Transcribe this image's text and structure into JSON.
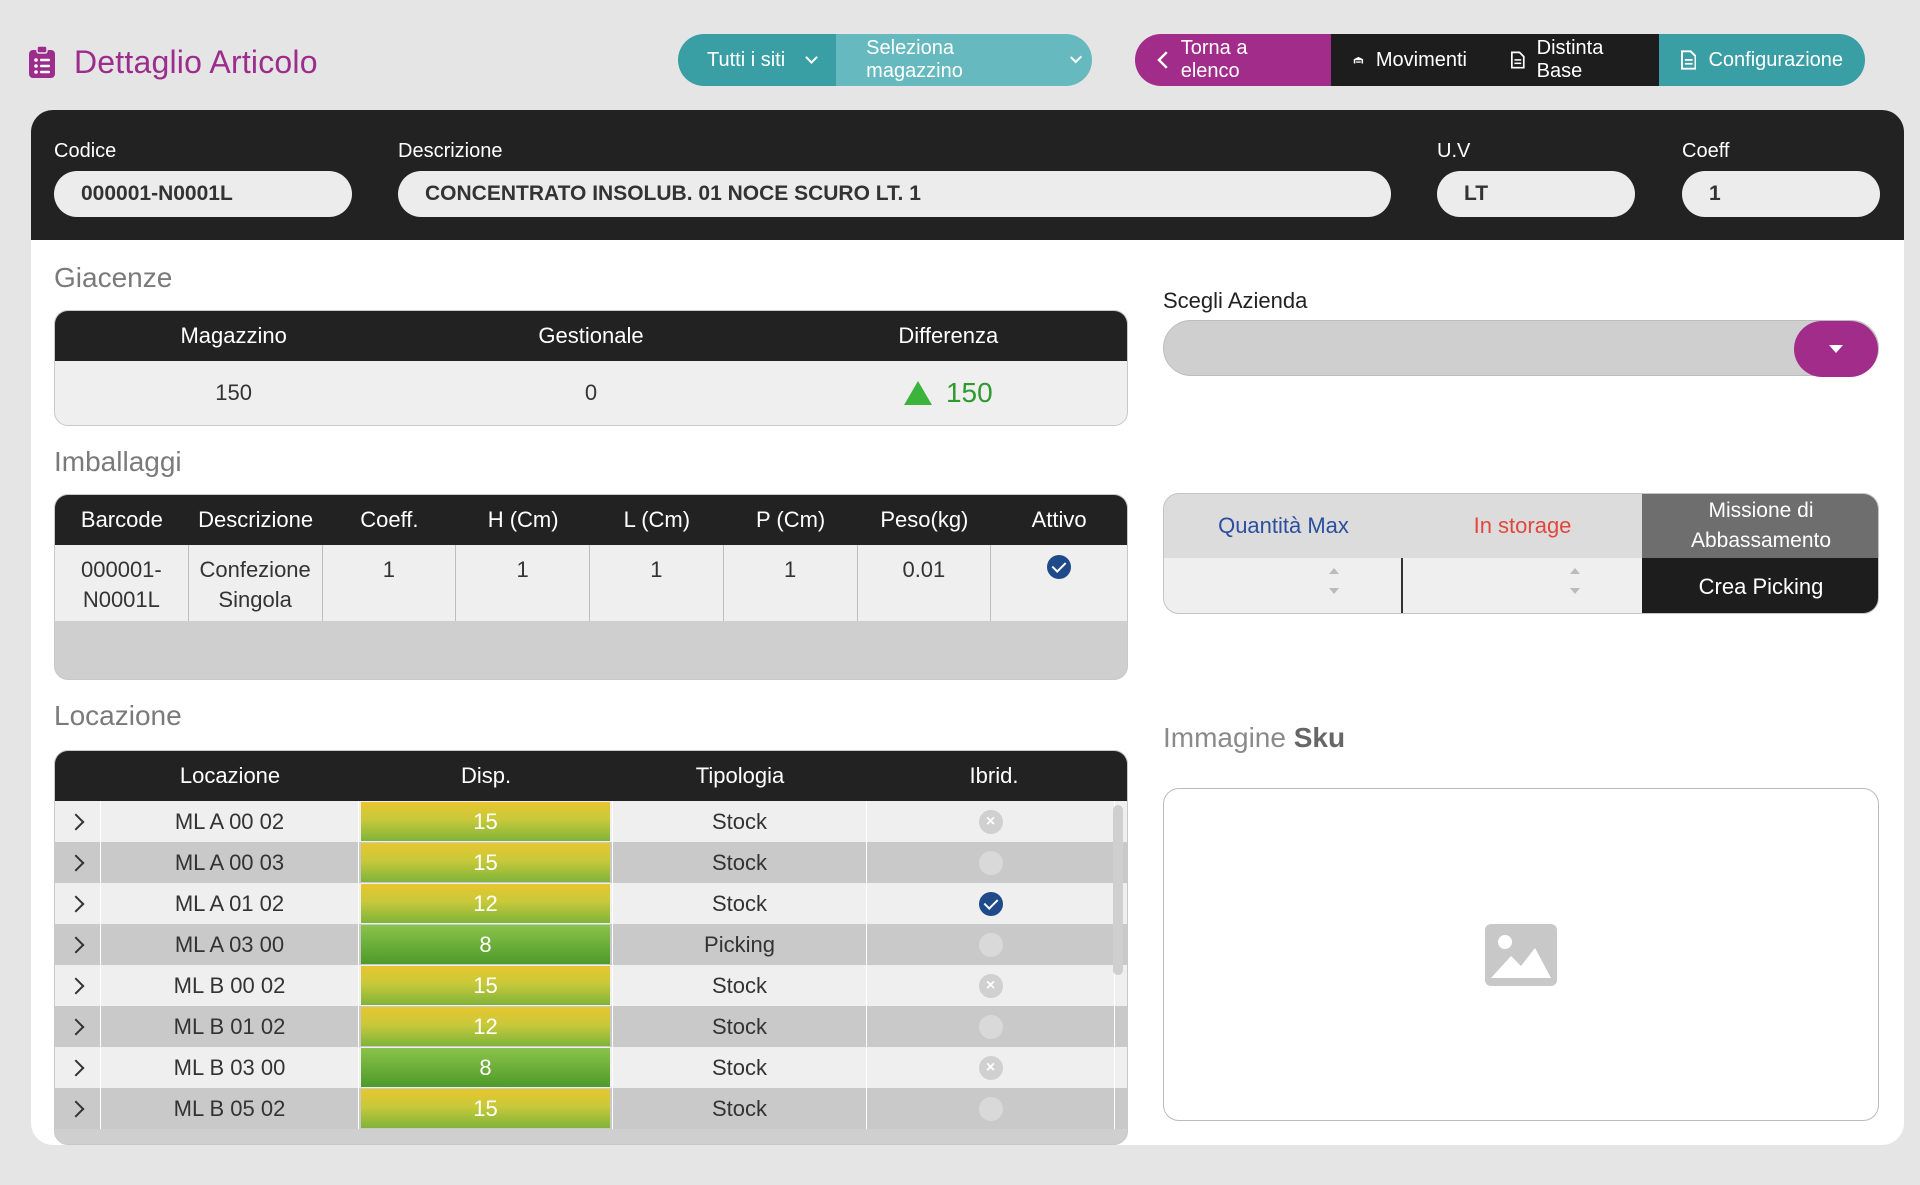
{
  "header": {
    "title": "Dettaglio Articolo",
    "site_selector": "Tutti i siti",
    "warehouse_selector": "Seleziona magazzino",
    "nav": {
      "back": "Torna a elenco",
      "movements": "Movimenti",
      "bom": "Distinta Base",
      "config": "Configurazione"
    }
  },
  "article": {
    "code_label": "Codice",
    "code": "000001-N0001L",
    "desc_label": "Descrizione",
    "desc": "CONCENTRATO INSOLUB. 01 NOCE SCURO LT.  1",
    "uv_label": "U.V",
    "uv": "LT",
    "coeff_label": "Coeff",
    "coeff": "1"
  },
  "giacenze": {
    "title": "Giacenze",
    "headers": [
      "Magazzino",
      "Gestionale",
      "Differenza"
    ],
    "values": {
      "magazzino": "150",
      "gestionale": "0",
      "differenza": "150"
    }
  },
  "imballaggi": {
    "title": "Imballaggi",
    "headers": [
      "Barcode",
      "Descrizione",
      "Coeff.",
      "H (Cm)",
      "L (Cm)",
      "P (Cm)",
      "Peso(kg)",
      "Attivo"
    ],
    "row": {
      "barcode_1": "000001-",
      "barcode_2": "N0001L",
      "desc_1": "Confezione",
      "desc_2": "Singola",
      "coeff": "1",
      "h": "1",
      "l": "1",
      "p": "1",
      "peso": "0.01",
      "attivo": true
    }
  },
  "locazione": {
    "title": "Locazione",
    "headers": [
      "Locazione",
      "Disp.",
      "Tipologia",
      "Ibrid."
    ],
    "rows": [
      {
        "loc": "ML A 00 02",
        "disp": "15",
        "tipo": "Stock",
        "ibrid": "x"
      },
      {
        "loc": "ML A 00 03",
        "disp": "15",
        "tipo": "Stock",
        "ibrid": "faint"
      },
      {
        "loc": "ML A 01 02",
        "disp": "12",
        "tipo": "Stock",
        "ibrid": "check"
      },
      {
        "loc": "ML A 03 00",
        "disp": "8",
        "tipo": "Picking",
        "ibrid": "faint"
      },
      {
        "loc": "ML B 00 02",
        "disp": "15",
        "tipo": "Stock",
        "ibrid": "x"
      },
      {
        "loc": "ML B 01 02",
        "disp": "12",
        "tipo": "Stock",
        "ibrid": "faint"
      },
      {
        "loc": "ML B 03 00",
        "disp": "8",
        "tipo": "Stock",
        "ibrid": "x"
      },
      {
        "loc": "ML B 05 02",
        "disp": "15",
        "tipo": "Stock",
        "ibrid": "faint"
      }
    ]
  },
  "azienda": {
    "label": "Scegli Azienda",
    "value": ""
  },
  "quantita": {
    "max_label": "Quantità Max",
    "storage_label": "In storage",
    "mission_label_1": "Missione di",
    "mission_label_2": "Abbassamento",
    "crea_label": "Crea Picking",
    "max_value": "",
    "storage_value": ""
  },
  "immagine": {
    "title_1": "Immagine",
    "title_2": "Sku"
  },
  "colors": {
    "accent_purple": "#a12c8a",
    "accent_teal": "#3a9ea5",
    "dark": "#1d1d1d",
    "positive_green": "#2e9a2e"
  }
}
